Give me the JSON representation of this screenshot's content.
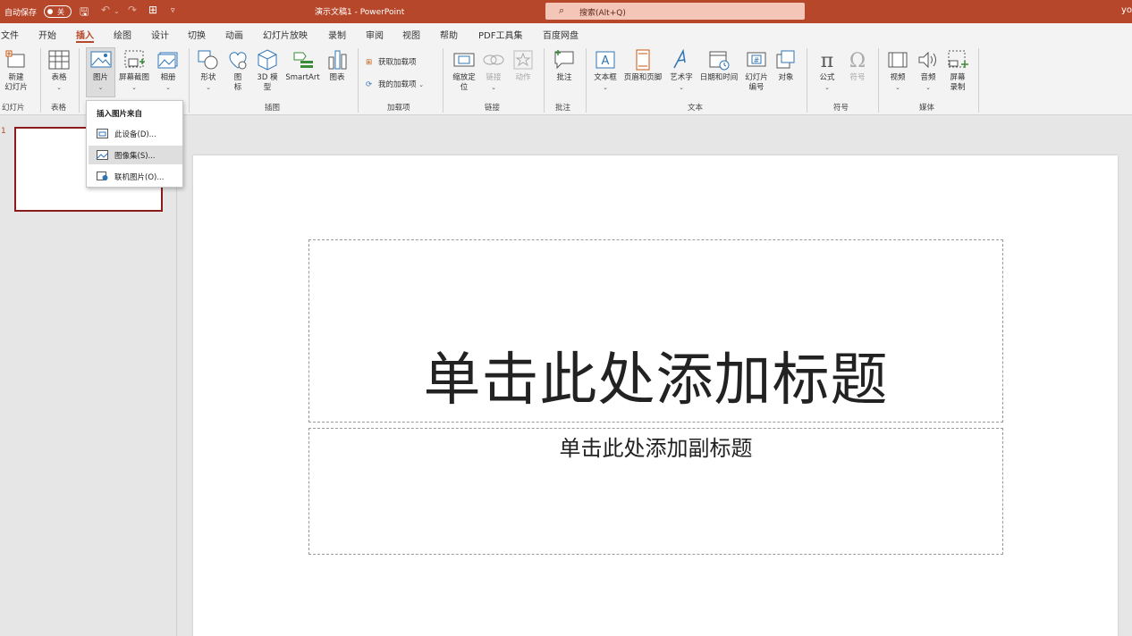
{
  "titlebar": {
    "autosave_label": "自动保存",
    "autosave_state": "关",
    "doc_title": "演示文稿1  -  PowerPoint",
    "search_placeholder": "搜索(Alt+Q)",
    "user": "yo"
  },
  "tabs": [
    "文件",
    "开始",
    "插入",
    "绘图",
    "设计",
    "切换",
    "动画",
    "幻灯片放映",
    "录制",
    "审阅",
    "视图",
    "帮助",
    "PDF工具集",
    "百度网盘"
  ],
  "active_tab": "插入",
  "ribbon": {
    "new_slide": "新建\n幻灯片",
    "table": "表格",
    "picture": "图片",
    "screenshot": "屏幕截图",
    "album": "相册",
    "shapes": "形状",
    "icons": "图\n标",
    "model3d": "3D 模\n型",
    "smartart": "SmartArt",
    "chart": "图表",
    "get_addins": "获取加载项",
    "my_addins": "我的加载项",
    "zoom": "缩放定\n位",
    "link": "链接",
    "action": "动作",
    "comment": "批注",
    "textbox": "文本框",
    "header_footer": "页眉和页脚",
    "wordart": "艺术字",
    "datetime": "日期和时间",
    "slide_number": "幻灯片\n编号",
    "object": "对象",
    "equation": "公式",
    "symbol": "符号",
    "video": "视频",
    "audio": "音频",
    "screen_record": "屏幕\n录制",
    "groups": {
      "slides": "幻灯片",
      "tables": "表格",
      "illustrations": "插图",
      "addins": "加载项",
      "links": "链接",
      "comments": "批注",
      "text": "文本",
      "symbols": "符号",
      "media": "媒体"
    }
  },
  "dropdown": {
    "header": "插入图片来自",
    "items": [
      "此设备(D)...",
      "图像集(S)...",
      "联机图片(O)..."
    ]
  },
  "slide_panel": {
    "number": "1"
  },
  "slide": {
    "title_placeholder": "单击此处添加标题",
    "subtitle_placeholder": "单击此处添加副标题"
  },
  "colors": {
    "accent": "#b7472a",
    "thumb_border": "#8b1c1c"
  }
}
